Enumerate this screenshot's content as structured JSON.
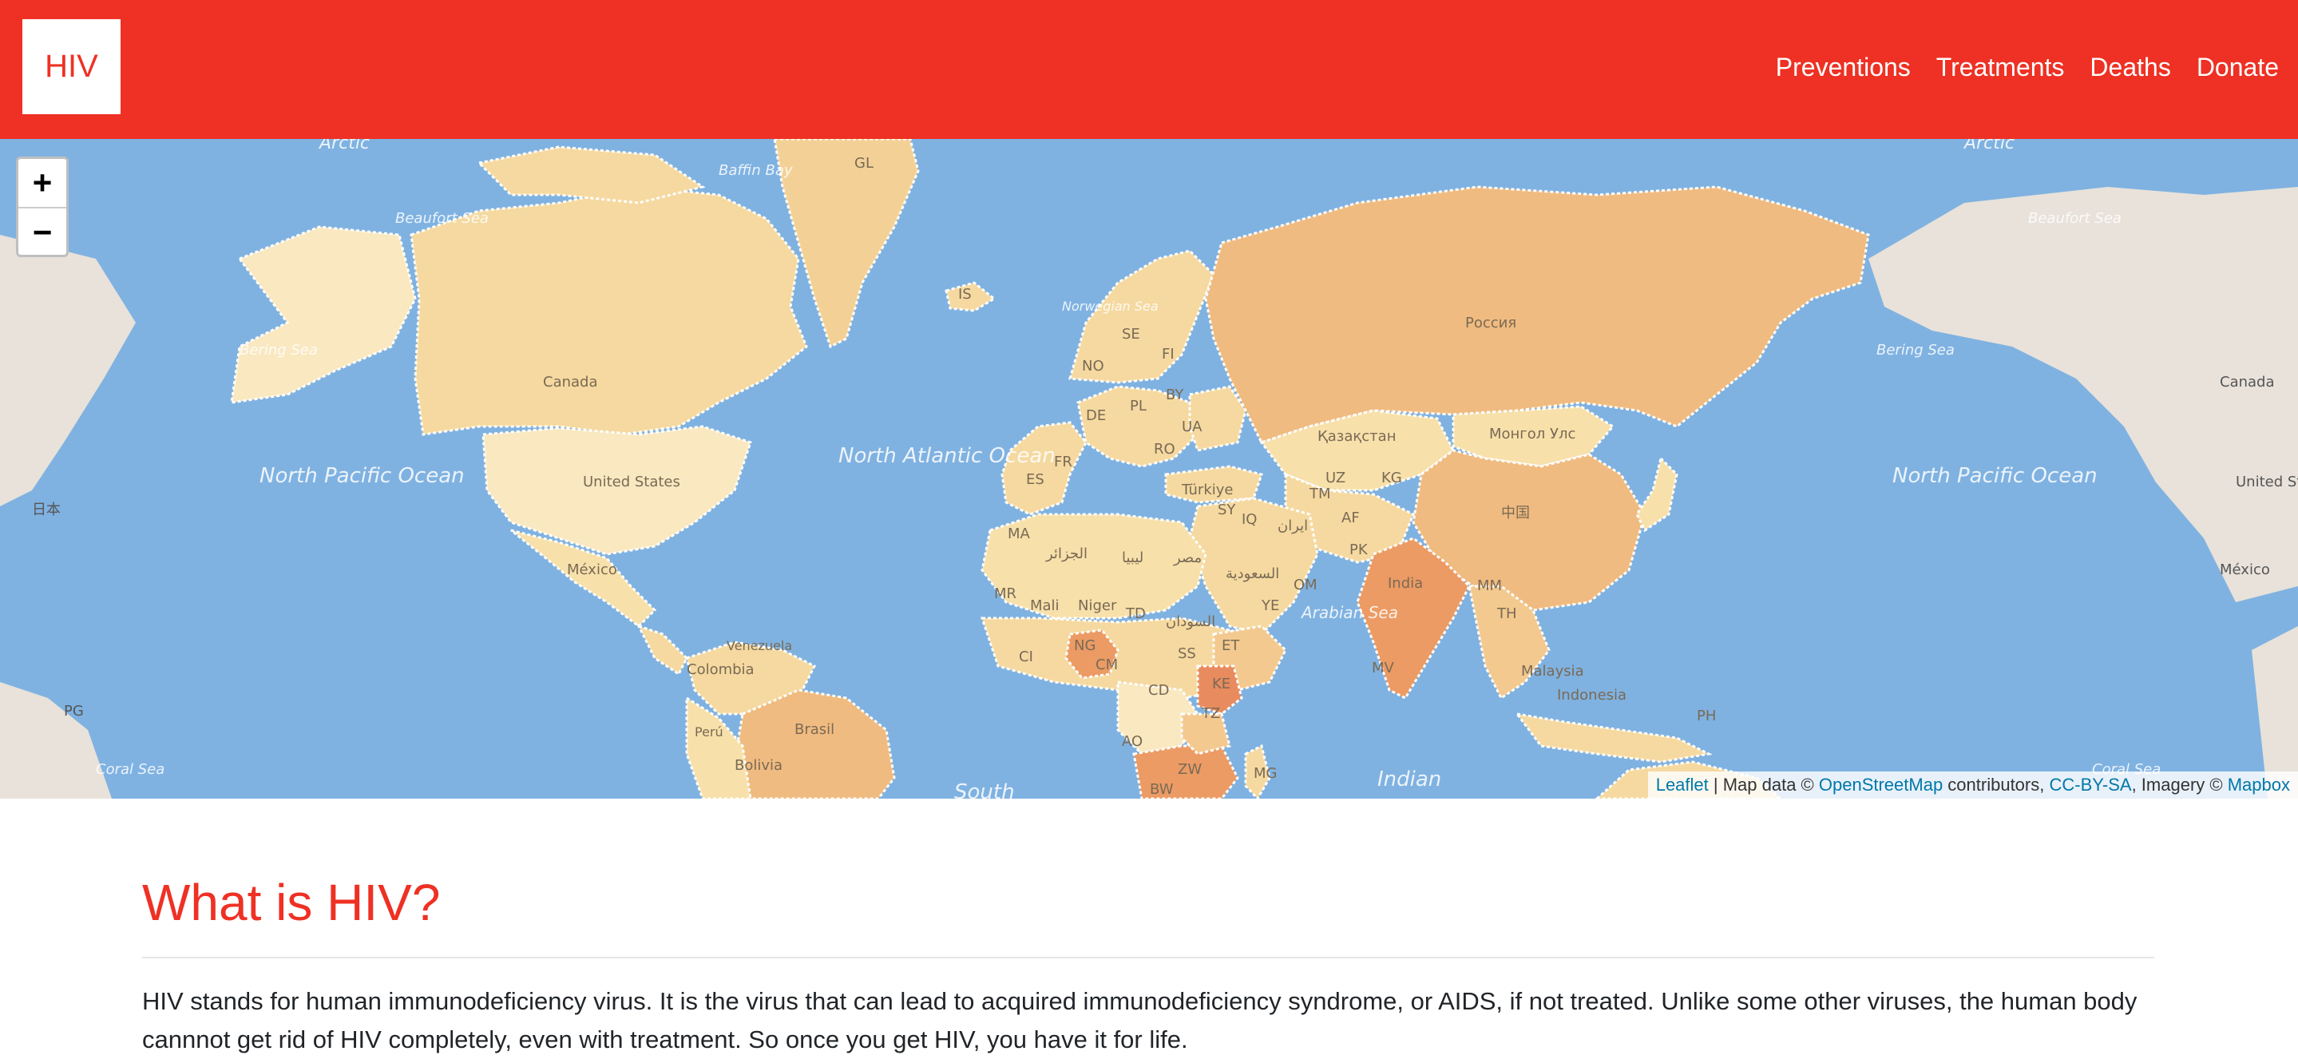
{
  "brand": {
    "label": "HIV"
  },
  "nav": [
    {
      "label": "Preventions"
    },
    {
      "label": "Treatments"
    },
    {
      "label": "Deaths"
    },
    {
      "label": "Donate"
    }
  ],
  "map": {
    "zoom_in": "+",
    "zoom_out": "−",
    "labels": {
      "arctic_left": "Arctic",
      "arctic_right": "Arctic",
      "beaufort_left": "Beaufort Sea",
      "beaufort_right": "Beaufort Sea",
      "baffin": "Baffin Bay",
      "gl": "GL",
      "is": "IS",
      "bering_left": "Bering Sea",
      "bering_right": "Bering Sea",
      "canada_left": "Canada",
      "canada_right": "Canada",
      "us_left": "United States",
      "us_right": "United States",
      "mexico_left": "México",
      "mexico_right": "México",
      "npo_left": "North Pacific Ocean",
      "npo_right": "North Pacific Ocean",
      "nao": "North Atlantic Ocean",
      "japan": "日本",
      "russia": "Россия",
      "kazakhstan": "Қазақстан",
      "mongolia": "Монгол Улс",
      "china": "中国",
      "india": "India",
      "brasil": "Brasil",
      "colombia": "Colombia",
      "peru": "Perú",
      "bolivia": "Bolivia",
      "venezuela": "Venezuela",
      "nigeria": "NG",
      "kenya": "KE",
      "ethiopia": "ET",
      "niger": "Niger",
      "mali": "Mali",
      "algeria": "الجزائر",
      "libya": "ليبيا",
      "egypt": "مصر",
      "sudan": "السودان",
      "saudi": "السعودية",
      "iran": "ایران",
      "turkiye": "Türkiye",
      "fr": "FR",
      "es": "ES",
      "de": "DE",
      "pl": "PL",
      "ua": "UA",
      "by": "BY",
      "se": "SE",
      "fi": "FI",
      "no": "NO",
      "ro": "RO",
      "uz": "UZ",
      "tm": "TM",
      "af": "AF",
      "pk": "PK",
      "iq": "IQ",
      "sy": "SY",
      "kg": "KG",
      "mm": "MM",
      "th": "TH",
      "mr": "MR",
      "td": "TD",
      "ss": "SS",
      "cd": "CD",
      "tz": "TZ",
      "ao": "AO",
      "zw": "ZW",
      "bw": "BW",
      "mg": "MG",
      "ma": "MA",
      "cm": "CM",
      "ci": "CI",
      "ye": "YE",
      "om": "OM",
      "mv": "MV",
      "pg": "PG",
      "ph": "PH",
      "malaysia": "Malaysia",
      "indonesia": "Indonesia",
      "arabian_sea": "Arabian Sea",
      "indian": "Indian",
      "south": "South",
      "coral_left": "Coral Sea",
      "coral_right": "Coral Sea",
      "norwegian": "Norwegian Sea"
    },
    "colors": {
      "ocean": "#7fb2e1",
      "land_base": "#e8e2da",
      "choropleth_low": "#f9e3b4",
      "choropleth_mid": "#f3c98f",
      "choropleth_high": "#eda96f",
      "choropleth_max": "#e88b5e"
    },
    "attribution": {
      "leaflet": "Leaflet",
      "sep": " | Map data © ",
      "osm": "OpenStreetMap",
      "contributors": " contributors, ",
      "license": "CC-BY-SA",
      "imagery": ", Imagery © ",
      "mapbox": "Mapbox"
    }
  },
  "content": {
    "heading": "What is HIV?",
    "paragraph": "HIV stands for human immunodeficiency virus. It is the virus that can lead to acquired immunodeficiency syndrome, or AIDS, if not treated. Unlike some other viruses, the human body cannnot get rid of HIV completely, even with treatment. So once you get HIV, you have it for life."
  }
}
